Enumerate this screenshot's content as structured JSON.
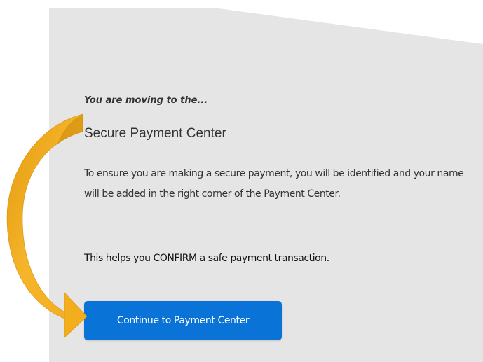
{
  "panel": {
    "background_color": "#e5e5e5"
  },
  "content": {
    "eyebrow": "You are moving to the...",
    "title": "Secure Payment Center",
    "description": "To ensure you are making a secure payment, you will be identified and your name will be added in the right corner of the Payment Center.",
    "confirm_text": "This helps you CONFIRM a safe payment transaction."
  },
  "cta": {
    "label": "Continue to Payment Center",
    "color": "#0a73d8"
  },
  "arrow": {
    "icon": "curved-arrow-icon",
    "color": "#f0a81c"
  }
}
